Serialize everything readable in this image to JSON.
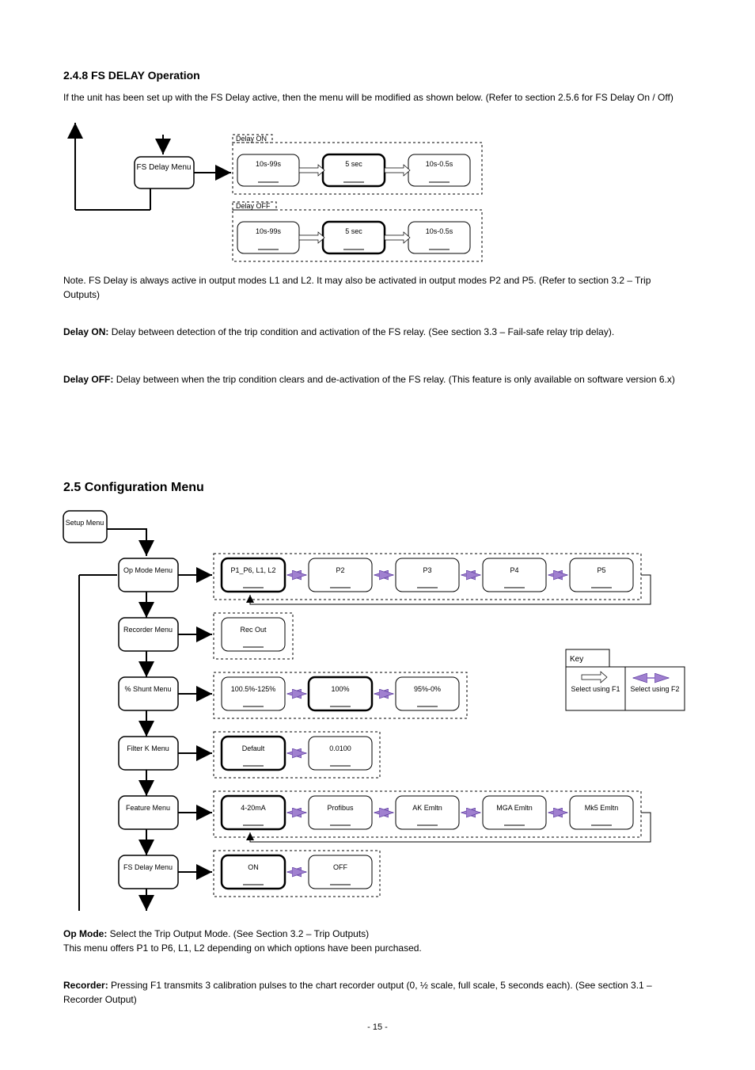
{
  "page": "- 15 -",
  "section1": {
    "title": "2.4.8 FS DELAY Operation",
    "intro": "If the unit has been set up with the FS Delay active, then the menu will be modified as shown below. (Refer to section 2.5.6 for FS Delay On / Off)",
    "menu": {
      "label": "FS Delay Menu",
      "delayOn": {
        "title": "Delay ON",
        "opt1": "10s-99s",
        "opt2": "5 sec",
        "opt3": "10s-0.5s"
      },
      "delayOff": {
        "title": "Delay OFF",
        "opt1": "10s-99s",
        "opt2": "5 sec",
        "opt3": "10s-0.5s"
      }
    },
    "note": "Note. FS Delay is always active in output modes L1 and L2. It may also be activated in output modes P2 and P5. (Refer to section 3.2 – Trip Outputs)",
    "delayOn": {
      "h": "Delay ON:",
      "t": "Delay between detection of the trip condition and activation of the FS relay. (See section 3.3 – Fail-safe relay trip delay)."
    },
    "delayOff": {
      "h": "Delay OFF:",
      "t": "Delay between when the trip condition clears and de-activation of the FS relay. (This feature is only available on software version 6.x)"
    }
  },
  "section2": {
    "title": "2.5 Configuration Menu",
    "setup": "Setup Menu",
    "rows": {
      "r1": {
        "label": "Op Mode Menu",
        "opts": [
          "P1_P6, L1, L2",
          "P2",
          "P3",
          "P4",
          "P5"
        ]
      },
      "r2": {
        "label": "Recorder Menu",
        "opts": [
          "Rec Out"
        ]
      },
      "r3": {
        "label": "% Shunt Menu",
        "opts": [
          "100.5%-125%",
          "100%",
          "95%-0%"
        ]
      },
      "r4": {
        "label": "Filter K Menu",
        "opts": [
          "Default",
          "0.0100"
        ]
      },
      "r5": {
        "label": "Feature Menu",
        "opts": [
          "4-20mA",
          "Profibus",
          "AK Emltn",
          "MGA Emltn",
          "Mk5 Emltn"
        ]
      },
      "r6": {
        "label": "FS Delay Menu",
        "opts": [
          "ON",
          "OFF"
        ]
      }
    },
    "legend": {
      "title": "Key",
      "left": "Select using F1",
      "right": "Select using F2"
    },
    "opMode": {
      "h": "Op Mode:",
      "t1": "Select the Trip Output Mode. (See Section 3.2 – Trip Outputs)",
      "t2": "This menu offers P1 to P6, L1, L2 depending on which options have been purchased."
    },
    "recorder": {
      "h": "Recorder:",
      "t": "Pressing F1 transmits 3 calibration pulses to the chart recorder output (0, ½ scale, full scale, 5 seconds each). (See section 3.1 – Recorder Output)"
    }
  }
}
